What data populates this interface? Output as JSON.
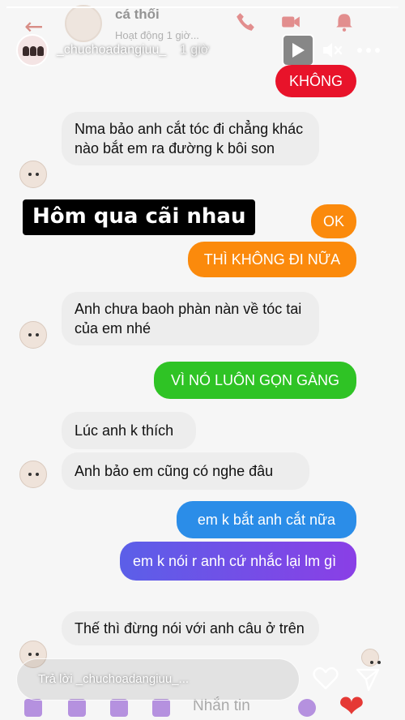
{
  "story": {
    "username": "_chuchoadangiuu_",
    "time_ago": "1 giờ",
    "progress": 0.98,
    "reply_placeholder": "Trả lời _chuchoadangiuu_..."
  },
  "messenger": {
    "contact_name": "cá thối",
    "status": "Hoạt động 1 giờ...",
    "composer_placeholder": "Nhắn tin"
  },
  "caption": "Hôm qua cãi nhau",
  "messages": [
    {
      "side": "right",
      "text": "KHÔNG",
      "color": "#e8132a"
    },
    {
      "side": "left",
      "text": "Nma bảo anh cắt tóc đi chẳng khác nào bắt em ra đường k bôi son"
    },
    {
      "side": "right",
      "text": "OK",
      "color": "#fb8a0c"
    },
    {
      "side": "right",
      "text": "THÌ KHÔNG ĐI NỮA",
      "color": "#fb8a0c"
    },
    {
      "side": "left",
      "text": "Anh chưa baoh phàn nàn về tóc tai của em nhé"
    },
    {
      "side": "right",
      "text": "VÌ NÓ LUÔN GỌN GÀNG",
      "color": "#2fc325"
    },
    {
      "side": "left",
      "text": "Lúc anh k thích"
    },
    {
      "side": "left",
      "text": "Anh bảo em cũng có nghe đâu"
    },
    {
      "side": "right",
      "text": "em k bắt anh cắt nữa",
      "color": "#2b8de8"
    },
    {
      "side": "right",
      "text": "em k nói r anh cứ nhắc lại lm gì",
      "color": "#6b4de6"
    },
    {
      "side": "left",
      "text": "Thế thì đừng nói với anh câu ở trên"
    }
  ],
  "icons": [
    "back-arrow-icon",
    "phone-icon",
    "video-icon",
    "bell-icon",
    "play-icon",
    "mute-icon",
    "more-icon",
    "heart-icon",
    "send-icon"
  ]
}
